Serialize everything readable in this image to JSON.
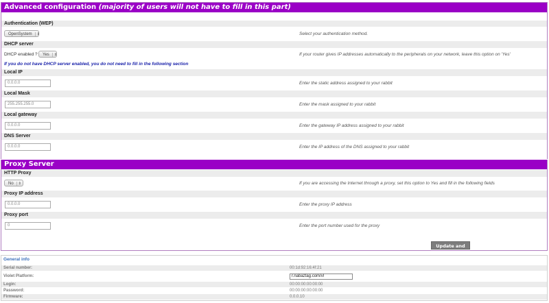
{
  "advanced": {
    "title": "Advanced configuration",
    "subtitle": "(majority of users will not have to fill in this part)",
    "auth_label": "Authentication (WEP)",
    "auth_value": "OpenSystem",
    "auth_desc": "Select your authentication method.",
    "dhcp_label": "DHCP server",
    "dhcp_enabled_label": "DHCP enabled ?",
    "dhcp_value": "Yes",
    "dhcp_desc": "If your router gives IP addresses automatically to the peripherals on your network, leave this option on 'Yes'",
    "dhcp_note": "If you do not have DHCP server enabled, you do not need to fill in the following section",
    "local_ip_label": "Local IP",
    "local_ip_value": "0.0.0.0",
    "local_ip_desc": "Enter the static address assigned to your rabbit",
    "local_mask_label": "Local Mask",
    "local_mask_value": "255.255.255.0",
    "local_mask_desc": "Enter the mask assigned to your rabbit",
    "gateway_label": "Local gateway",
    "gateway_value": "0.0.0.0",
    "gateway_desc": "Enter the gateway IP address assigned to your rabbit",
    "dns_label": "DNS Server",
    "dns_value": "0.0.0.0",
    "dns_desc": "Enter the IP address of the DNS assigned to your rabbit"
  },
  "proxy": {
    "title": "Proxy Server",
    "http_label": "HTTP Proxy",
    "http_value": "No",
    "http_desc": "If you are accessing the Internet through a proxy, set this option to Yes and fill in the following fields",
    "ip_label": "Proxy IP address",
    "ip_value": "0.0.0.0",
    "ip_desc": "Enter the proxy IP address",
    "port_label": "Proxy port",
    "port_value": "0",
    "port_desc": "Enter the port number used for the proxy",
    "submit_label": "Update and Start"
  },
  "info": {
    "title": "General info",
    "serial_label": "Serial number:",
    "serial_value": "00:1d:92:16:4f:21",
    "platform_label": "Violet Platform:",
    "platform_value": "r.nabaztag.com/vl",
    "login_label": "Login:",
    "login_value": "00:00:00:00:00:00",
    "password_label": "Password:",
    "password_value": "00:00:00:00:00:00",
    "firmware_label": "Firmware:",
    "firmware_value": "0.0.0.10"
  },
  "colors": {
    "header": "#9a00c6",
    "note": "#1a22aa",
    "info_title": "#3a6fbb",
    "button": "#7d7d7d"
  }
}
